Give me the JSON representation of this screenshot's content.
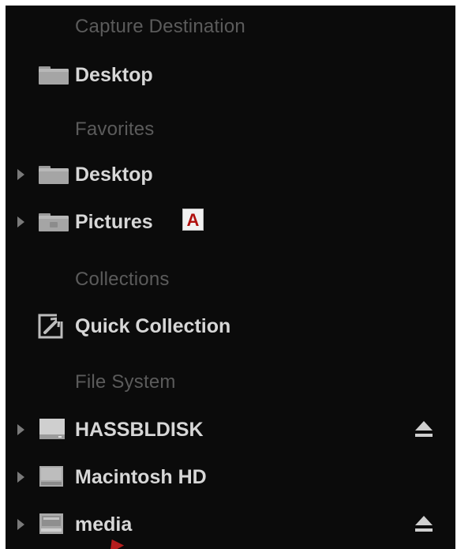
{
  "sections": {
    "capture": {
      "header": "Capture Destination",
      "item": "Desktop"
    },
    "favorites": {
      "header": "Favorites",
      "items": [
        "Desktop",
        "Pictures"
      ]
    },
    "collections": {
      "header": "Collections",
      "item": "Quick Collection"
    },
    "filesystem": {
      "header": "File System",
      "items": [
        "HASSBLDISK",
        "Macintosh HD",
        "media"
      ]
    }
  },
  "annotation": {
    "badge": "A"
  },
  "icons": {
    "folder": "folder-icon",
    "collection": "quick-collection-icon",
    "drive": "hard-drive-icon",
    "eject": "eject-icon",
    "disclosure": "disclosure-triangle-icon"
  },
  "colors": {
    "panel_bg": "#0b0b0b",
    "header_text": "#5b5b5b",
    "item_text": "#d7d7d7",
    "badge_text": "#b0100e",
    "badge_bg": "#f1f1f1"
  }
}
